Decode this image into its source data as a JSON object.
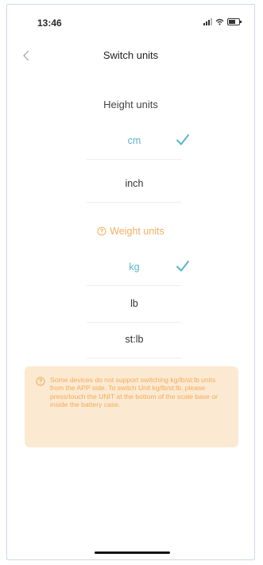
{
  "status_bar": {
    "time": "13:46"
  },
  "nav": {
    "title": "Switch units"
  },
  "height_section": {
    "title": "Height units",
    "options": [
      {
        "label": "cm",
        "selected": true
      },
      {
        "label": "inch",
        "selected": false
      }
    ]
  },
  "weight_section": {
    "title": "Weight units",
    "options": [
      {
        "label": "kg",
        "selected": true
      },
      {
        "label": "lb",
        "selected": false
      },
      {
        "label": "st:lb",
        "selected": false
      }
    ]
  },
  "notice": {
    "text": "Some devices do not support switching kg/lb/st:lb units from the APP side. To switch Unit kg/lb/st:lb, please press/touch the UNIT at the bottom of the scale base or inside the battery case."
  },
  "colors": {
    "accent": "#5ab6c9",
    "warning": "#f1ac58",
    "warning_bg": "#fce9d2"
  },
  "icons": {
    "back": "chevron-left-icon",
    "check": "checkmark-icon",
    "info": "info-circle-icon"
  }
}
